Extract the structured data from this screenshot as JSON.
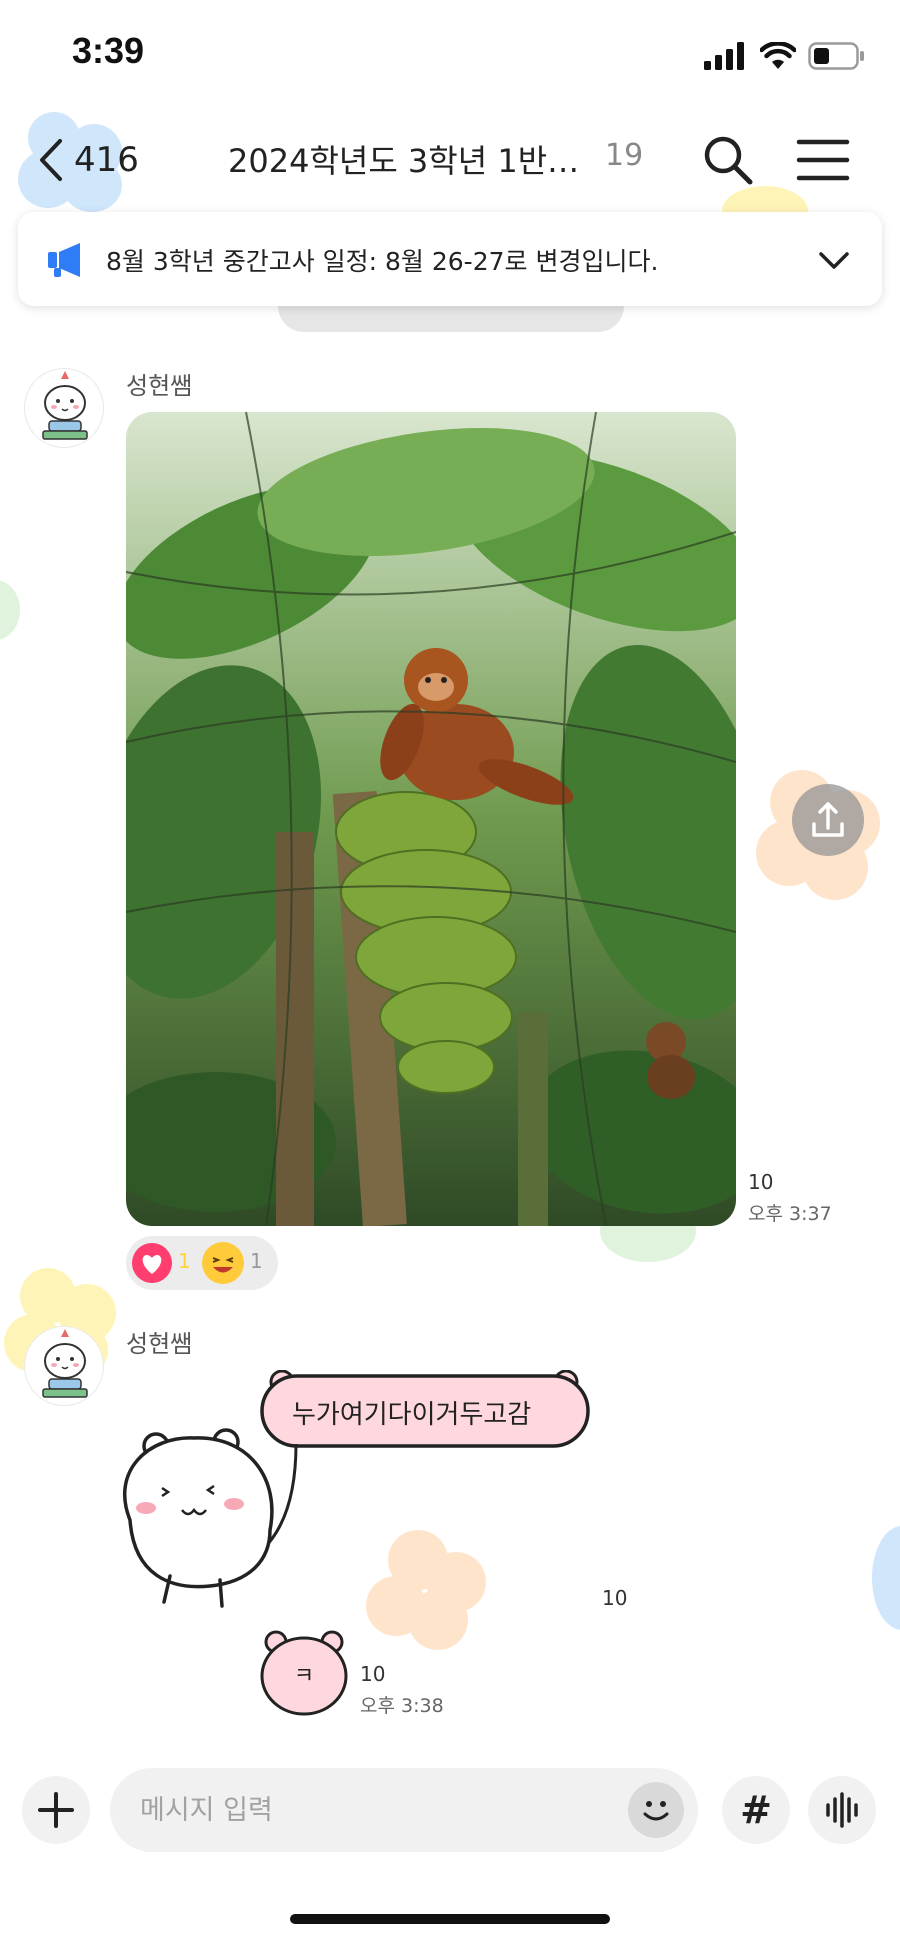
{
  "status_bar": {
    "time": "3:39"
  },
  "header": {
    "back_count": "416",
    "title": "2024학년도 3학년 1반…",
    "member_count": "19"
  },
  "notice": {
    "text": "8월 3학년 중간고사 일정: 8월 26-27로 변경입니다."
  },
  "messages": [
    {
      "sender": "성현쌤",
      "type": "photo",
      "unread_count": "10",
      "time": "오후 3:37",
      "reactions": {
        "heart_count": "1",
        "face_count": "1"
      }
    },
    {
      "sender": "성현쌤",
      "type": "emoticon",
      "speech_text": "누가여기다이거두고감",
      "unread_count": "10"
    },
    {
      "type": "small-emoticon",
      "glyph": "ㅋ",
      "unread_count": "10",
      "time": "오후 3:38"
    }
  ],
  "input": {
    "placeholder": "메시지 입력"
  },
  "colors": {
    "notice_icon": "#2f7df6",
    "heart": "#ff3d6e",
    "emoticon_bubble": "#ffd8df",
    "blob_blue": "#cfe6fb",
    "blob_yellow": "#fff4b8",
    "blob_peach": "#ffe4cc",
    "blob_green": "#dff3dd"
  },
  "icons": [
    "back-chevron-icon",
    "search-icon",
    "menu-icon",
    "megaphone-icon",
    "chevron-down-icon",
    "share-icon",
    "heart-icon",
    "laughing-face-icon",
    "plus-icon",
    "emoji-icon",
    "hash-icon",
    "voice-icon"
  ]
}
